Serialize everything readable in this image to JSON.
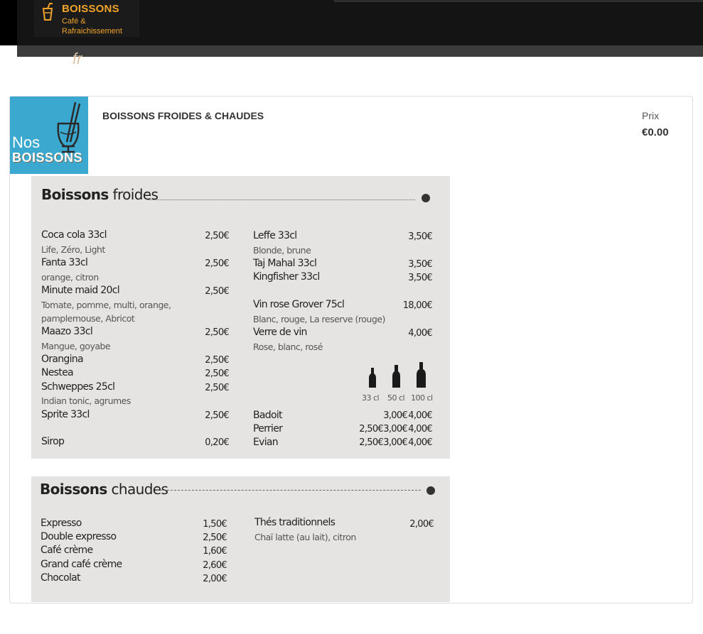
{
  "category": {
    "icon": "drink-icon",
    "title": "BOISSONS",
    "subtitle": "Café & Rafraichissement",
    "accent": "#f0a32a"
  },
  "product": {
    "title": "BOISSONS FROIDES & CHAUDES",
    "price_label": "Prix",
    "price_value": "€0.00",
    "thumbnail": {
      "line1": "Nos",
      "line2": "BOISSONS",
      "suffix": "fr",
      "background": "#3aa8cf"
    }
  },
  "menu": {
    "cold": {
      "title_bold": "Boissons",
      "title_light": "froides",
      "left": [
        {
          "name": "Coca cola  33cl",
          "price": "2,50€",
          "desc": "Life, Zéro, Light"
        },
        {
          "name": "Fanta  33cl",
          "price": "2,50€",
          "desc": "orange, citron"
        },
        {
          "name": "Minute maid 20cl",
          "price": "2,50€",
          "desc": "Tomate, pomme, multi, orange,",
          "desc2": "pamplemouse, Abricot"
        },
        {
          "name": "Maazo 33cl",
          "price": "2,50€",
          "desc": "Mangue, goyabe"
        },
        {
          "name": "Orangina",
          "price": "2,50€"
        },
        {
          "name": "Nestea",
          "price": "2,50€"
        },
        {
          "name": "Schweppes 25cl",
          "price": "2,50€",
          "desc": "Indian tonic, agrumes"
        },
        {
          "name": "Sprite 33cl",
          "price": "2,50€"
        },
        {
          "name": "Sirop",
          "price": "0,20€"
        }
      ],
      "right": [
        {
          "name": "Leffe 33cl",
          "price": "3,50€",
          "desc": "Blonde, brune"
        },
        {
          "name": "Taj Mahal 33cl",
          "price": "3,50€"
        },
        {
          "name": "Kingfisher 33cl",
          "price": "3,50€"
        },
        {
          "name": "Vin rose Grover 75cl",
          "price": "18,00€",
          "desc": "Blanc, rouge, La reserve (rouge)"
        },
        {
          "name": "Verre de vin",
          "price": "4,00€",
          "desc": "Rose, blanc, rosé"
        }
      ],
      "bottle_sizes": [
        "33 cl",
        "50 cl",
        "100 cl"
      ],
      "waters": [
        {
          "name": "Badoit",
          "prices": [
            "",
            "3,00€",
            "4,00€"
          ]
        },
        {
          "name": "Perrier",
          "prices": [
            "2,50€",
            "3,00€",
            "4,00€"
          ]
        },
        {
          "name": "Evian",
          "prices": [
            "2,50€",
            "3,00€",
            "4,00€"
          ]
        }
      ]
    },
    "hot": {
      "title_bold": "Boissons",
      "title_light": "chaudes",
      "left": [
        {
          "name": "Expresso",
          "price": "1,50€"
        },
        {
          "name": "Double expresso",
          "price": "2,50€"
        },
        {
          "name": "Café crème",
          "price": "1,60€"
        },
        {
          "name": "Grand café crème",
          "price": "2,60€"
        },
        {
          "name": "Chocolat",
          "price": "2,00€"
        }
      ],
      "right": [
        {
          "name": "Thés traditionnels",
          "price": "2,00€",
          "desc": "Chaï latte (au lait), citron"
        }
      ]
    }
  }
}
